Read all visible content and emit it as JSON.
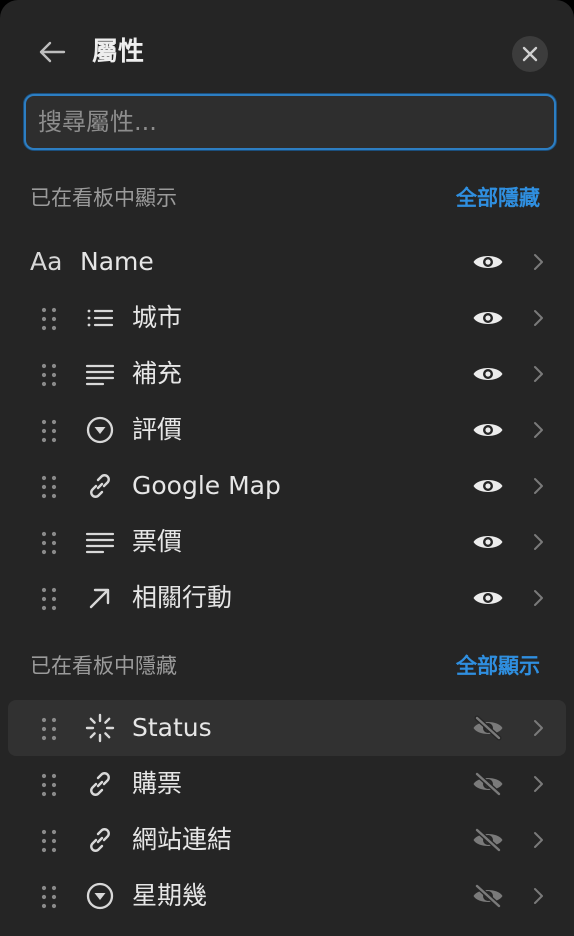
{
  "header": {
    "title": "屬性"
  },
  "search": {
    "placeholder": "搜尋屬性..."
  },
  "sections": {
    "shown": {
      "label": "已在看板中顯示",
      "action": "全部隱藏"
    },
    "hidden": {
      "label": "已在看板中隱藏",
      "action": "全部顯示"
    }
  },
  "name_row": {
    "type_icon": "Aa",
    "label": "Name"
  },
  "shown_items": [
    {
      "label": "城市",
      "icon": "list-icon"
    },
    {
      "label": "補充",
      "icon": "text-icon"
    },
    {
      "label": "評價",
      "icon": "select-icon"
    },
    {
      "label": "Google Map",
      "icon": "link-icon"
    },
    {
      "label": "票價",
      "icon": "text-icon"
    },
    {
      "label": "相關行動",
      "icon": "relation-arrow-icon"
    }
  ],
  "hidden_items": [
    {
      "label": "Status",
      "icon": "status-icon"
    },
    {
      "label": "購票",
      "icon": "link-icon"
    },
    {
      "label": "網站連結",
      "icon": "link-icon"
    },
    {
      "label": "星期幾",
      "icon": "select-icon"
    }
  ],
  "colors": {
    "panel_bg": "#252525",
    "accent": "#2f8fe0",
    "text": "#e6e6e6",
    "muted": "#9b9b9b"
  }
}
